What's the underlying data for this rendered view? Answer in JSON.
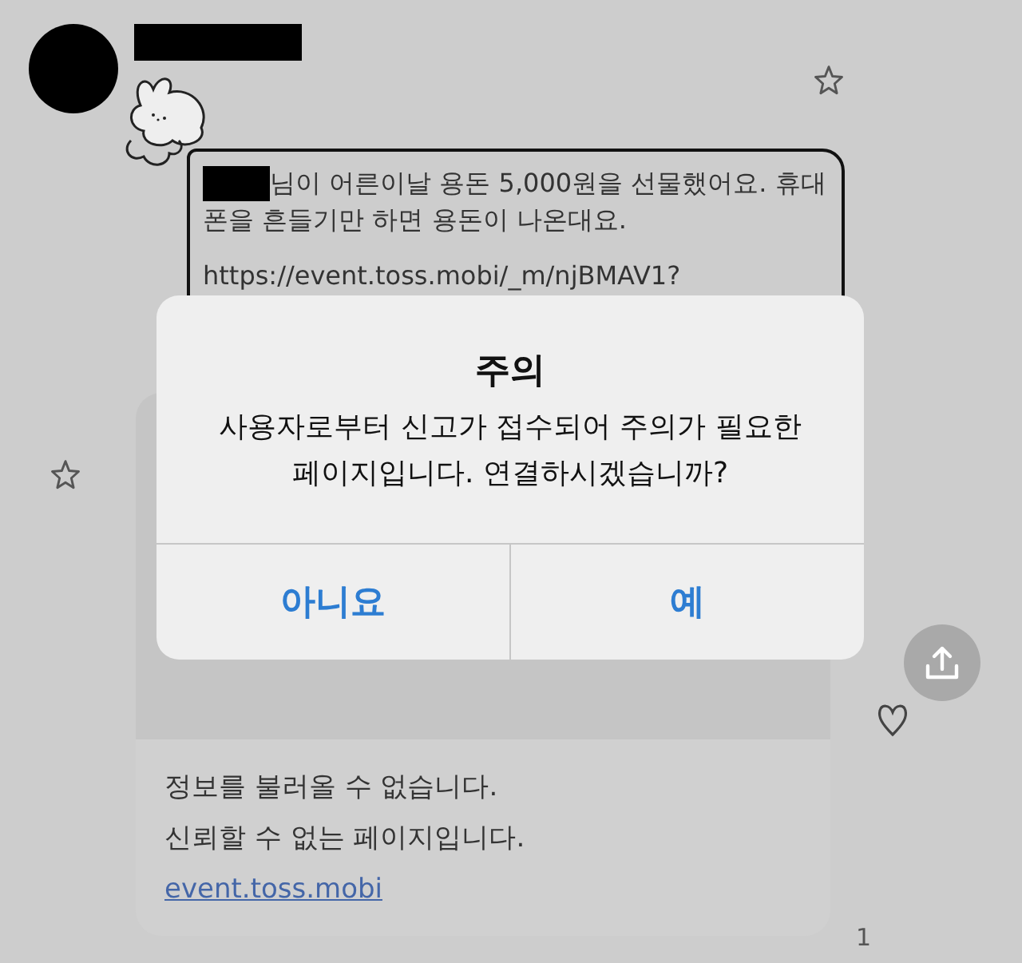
{
  "message": {
    "lines": [
      "님이 어른이날 용돈 5,000원을 선물했어요. 휴대",
      "폰을 흔들기만 하면 용돈이 나온대요."
    ],
    "url": "https://event.toss.mobi/_m/njBMAV1?"
  },
  "link_preview": {
    "lines": [
      "정보를 불러올 수 없습니다.",
      "신뢰할 수 없는 페이지입니다."
    ],
    "domain": "event.toss.mobi"
  },
  "read_count": "1",
  "dialog": {
    "title": "주의",
    "message_lines": [
      "사용자로부터 신고가 접수되어 주의가 필요한",
      "페이지입니다. 연결하시겠습니까?"
    ],
    "buttons": [
      "아니요",
      "예"
    ]
  }
}
